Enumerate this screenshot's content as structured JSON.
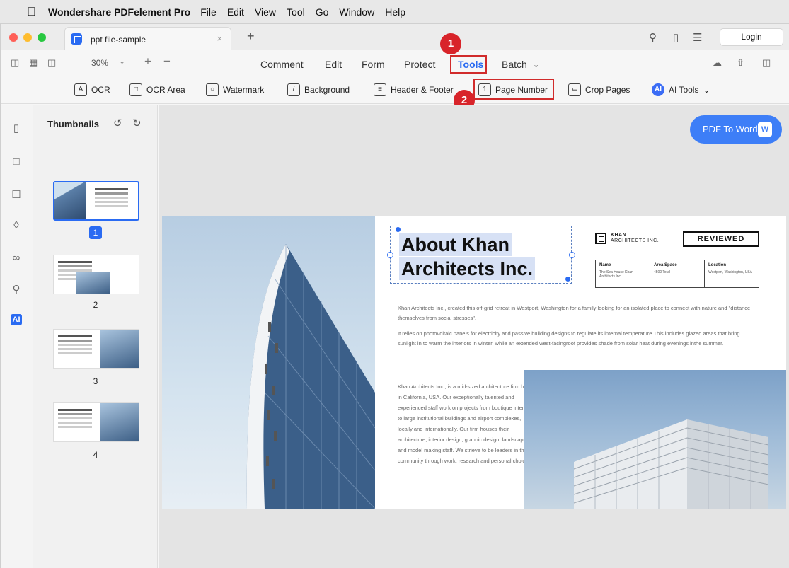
{
  "menubar": {
    "app_name": "Wondershare PDFelement Pro",
    "items": [
      "File",
      "Edit",
      "View",
      "Tool",
      "Go",
      "Window",
      "Help"
    ]
  },
  "tabbar": {
    "tab_title": "ppt file-sample",
    "login_label": "Login"
  },
  "toolbar": {
    "zoom": "30%",
    "tabs": [
      "Comment",
      "Edit",
      "Form",
      "Protect",
      "Tools",
      "Batch"
    ],
    "active_tab": "Tools"
  },
  "ribbon": {
    "tools": [
      "OCR",
      "OCR Area",
      "Watermark",
      "Background",
      "Header & Footer",
      "Page Number",
      "Crop Pages",
      "AI Tools"
    ],
    "highlighted_tool": "Page Number"
  },
  "annotations": {
    "step1": "1",
    "step2": "2",
    "color": "#d8242a"
  },
  "sidebar": {
    "title": "Thumbnails",
    "pages": [
      "1",
      "2",
      "3",
      "4"
    ],
    "selected_page": "1"
  },
  "canvas": {
    "pdf_to_word_label": "PDF To Word"
  },
  "document": {
    "heading_line1": "About Khan",
    "heading_line2": "Architects Inc.",
    "logo_line1": "KHAN",
    "logo_line2": "ARCHITECTS INC.",
    "badge": "REVIEWED",
    "table": {
      "headers": [
        "Name",
        "Area Space",
        "Location"
      ],
      "values": [
        "The Sea House Khan Architects Inc.",
        "4500 Total",
        "Westport, Washington, USA"
      ]
    },
    "para1": "Khan Architects Inc., created this off-grid retreat in Westport, Washington for a family looking for an isolated place to connect with nature and \"distance themselves from social stresses\".",
    "para2": "It relies on photovoltaic panels for electricity and passive building designs to regulate its internal temperature.This includes glazed areas that bring sunlight in to warm the interiors in winter, while an extended west-facingroof provides shade from solar heat during evenings inthe summer.",
    "para3": "Khan Architects Inc., is a mid-sized architecture firm based in California, USA. Our exceptionally talented and experienced staff work on projects from boutique interiors to large institutional buildings and airport complexes, locally and internationally. Our firm houses their architecture, interior design, graphic design, landscape and model making staff. We strieve to be leaders in the community through work, research and personal choices."
  },
  "colors": {
    "accent": "#2a6bf2",
    "annotation_red": "#d12b2b"
  }
}
